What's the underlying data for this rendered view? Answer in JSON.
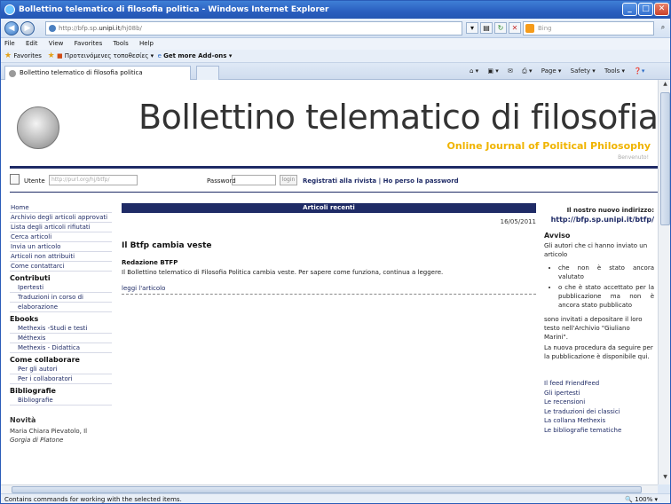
{
  "window": {
    "title": "Bollettino telematico di filosofia politica - Windows Internet Explorer"
  },
  "address_bar": {
    "url_prefix": "http://bfp.sp.",
    "url_domain": "unipi.it",
    "url_suffix": "/hj08b/",
    "search_placeholder": "Bing"
  },
  "menu": [
    "File",
    "Edit",
    "View",
    "Favorites",
    "Tools",
    "Help"
  ],
  "favorites_bar": {
    "favorites": "Favorites",
    "suggested": "Προτεινόμενες τοποθεσίες ▾",
    "addons": "Get more Add-ons ▾"
  },
  "tab": {
    "label": "Bollettino telematico di filosofia politica"
  },
  "commands": [
    "Page ▾",
    "Safety ▾",
    "Tools ▾"
  ],
  "site": {
    "title": "Bollettino telematico di filosofia politica",
    "subtitle": "Online Journal of Political Philosophy",
    "welcome": "Benvenuto!"
  },
  "login": {
    "user_label": "Utente",
    "user_placeholder": "http://purl.org/hj/btfp/",
    "password_label": "Password",
    "login_button": "login",
    "register": "Registrati alla rivista",
    "separator": "|",
    "lost_password": "Ho perso la password"
  },
  "sidebar": {
    "items": [
      {
        "label": "Home",
        "kind": "item"
      },
      {
        "label": "Archivio degli articoli approvati",
        "kind": "item"
      },
      {
        "label": "Lista degli articoli rifiutati",
        "kind": "item"
      },
      {
        "label": "Cerca articoli",
        "kind": "item"
      },
      {
        "label": "Invia un articolo",
        "kind": "item"
      },
      {
        "label": "Articoli non attribuiti",
        "kind": "item"
      },
      {
        "label": "Come contattarci",
        "kind": "item"
      },
      {
        "label": "Contributi",
        "kind": "sec"
      },
      {
        "label": "Ipertesti",
        "kind": "sub"
      },
      {
        "label": "Traduzioni in corso di",
        "kind": "sub"
      },
      {
        "label": "elaborazione",
        "kind": "sub"
      },
      {
        "label": "Ebooks",
        "kind": "sec"
      },
      {
        "label": "Methexis -Studi e testi",
        "kind": "sub"
      },
      {
        "label": "Méthexis",
        "kind": "sub"
      },
      {
        "label": "Methexis - Didattica",
        "kind": "sub"
      },
      {
        "label": "Come collaborare",
        "kind": "sec"
      },
      {
        "label": "Per gli autori",
        "kind": "sub"
      },
      {
        "label": "Per i collaboratori",
        "kind": "sub"
      },
      {
        "label": "Bibliografie",
        "kind": "sec"
      },
      {
        "label": "Bibliografie",
        "kind": "sub"
      }
    ],
    "novita_title": "Novità",
    "novita_author": "Maria Chiara Pievatolo, Il",
    "novita_work": "Gorgia di Platone"
  },
  "main": {
    "header": "Articoli recenti",
    "date": "16/05/2011",
    "article_title": "Il Btfp cambia veste",
    "author": "Redazione BTFP",
    "body": "Il Bollettino telematico di Filosofia Politica cambia veste. Per sapere come funziona, continua a leggere.",
    "read_more": "leggi l'articolo"
  },
  "right": {
    "new_address_label": "Il nostro nuovo indirizzo:",
    "new_address_url": "http://bfp.sp.unipi.it/btfp/",
    "notice_title": "Avviso",
    "notice_intro": "Gli autori che ci hanno inviato un articolo",
    "bullets": [
      "che non è stato ancora valutato",
      "o che è stato accettato per la pubblicazione ma non è ancora stato pubblicato"
    ],
    "notice_text1": "sono invitati a depositare il loro testo nell'Archivio \"Giuliano Marini\".",
    "notice_text2": "La nuova procedura da seguire per la pubblicazione è disponibile qui.",
    "links": [
      "Il feed FriendFeed",
      "Gli ipertesti",
      "Le recensioni",
      "Le traduzioni dei classici",
      "La collana Methexis",
      "Le bibliografie tematiche"
    ]
  },
  "status": {
    "text": "Contains commands for working with the selected items.",
    "zoom": "100% ▾"
  }
}
